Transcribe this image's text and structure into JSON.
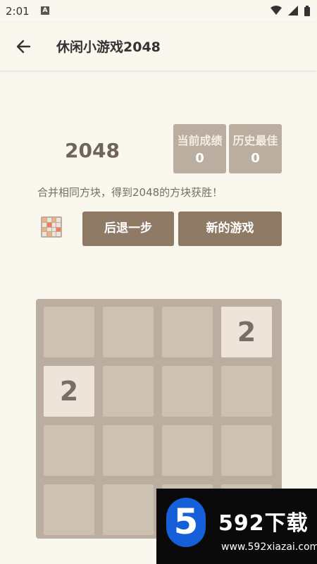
{
  "status_bar": {
    "time": "2:01",
    "notification_badge": "A",
    "icons": [
      "wifi-icon",
      "signal-icon",
      "battery-icon"
    ]
  },
  "app_bar": {
    "back_icon": "arrow-left-icon",
    "title": "休闲小游戏2048"
  },
  "game": {
    "logo": "2048",
    "scores": {
      "current_label": "当前成绩",
      "current_value": "0",
      "best_label": "历史最佳",
      "best_value": "0"
    },
    "instruction": "合并相同方块，得到2048的方块获胜！",
    "buttons": {
      "undo": "后退一步",
      "new_game": "新的游戏"
    },
    "board": {
      "rows": [
        [
          "",
          "",
          "",
          "2"
        ],
        [
          "2",
          "",
          "",
          ""
        ],
        [
          "",
          "",
          "",
          ""
        ],
        [
          "",
          "",
          "",
          ""
        ]
      ]
    }
  },
  "watermark": {
    "mark": "5",
    "brand": "592下载",
    "url": "www.592xiazai.com"
  },
  "colors": {
    "background": "#FAF7EF",
    "board": "#BBADA0",
    "empty_cell": "#CDC1B4",
    "tile_2": "#EEE4DA",
    "button": "#8F7A66",
    "text": "#776E65"
  }
}
